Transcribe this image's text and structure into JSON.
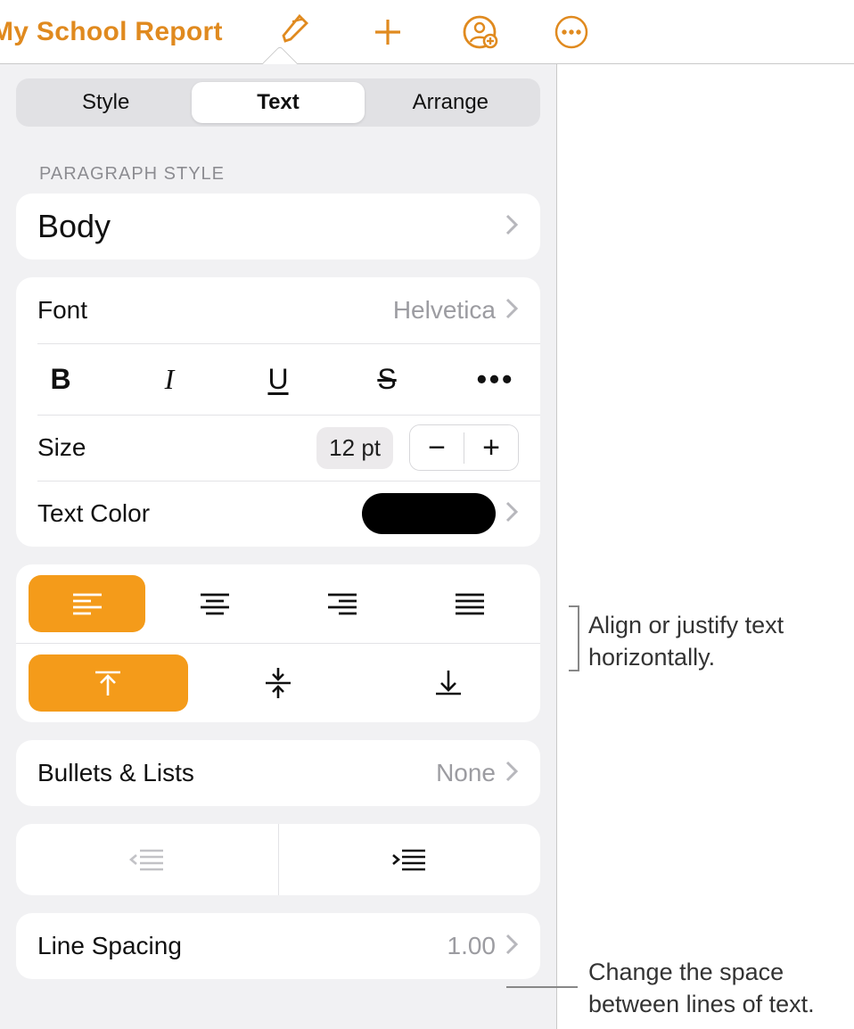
{
  "toolbar": {
    "title": "My School Report"
  },
  "tabs": {
    "style": "Style",
    "text": "Text",
    "arrange": "Arrange",
    "active": "text"
  },
  "sections": {
    "paragraph_style_label": "PARAGRAPH STYLE",
    "paragraph_style_value": "Body",
    "font_label": "Font",
    "font_value": "Helvetica",
    "size_label": "Size",
    "size_value": "12 pt",
    "text_color_label": "Text Color",
    "text_color_value": "#000000",
    "bullets_label": "Bullets & Lists",
    "bullets_value": "None",
    "line_spacing_label": "Line Spacing",
    "line_spacing_value": "1.00"
  },
  "style_buttons": {
    "bold": "B",
    "italic": "I",
    "underline": "U",
    "strike": "S",
    "more": "•••"
  },
  "stepper": {
    "minus": "−",
    "plus": "+"
  },
  "alignment": {
    "horizontal": [
      "left",
      "center",
      "right",
      "justify"
    ],
    "horizontal_active": "left",
    "vertical": [
      "top",
      "middle",
      "bottom"
    ],
    "vertical_active": "top"
  },
  "callouts": {
    "align": "Align or justify text horizontally.",
    "spacing": "Change the space between lines of text."
  }
}
